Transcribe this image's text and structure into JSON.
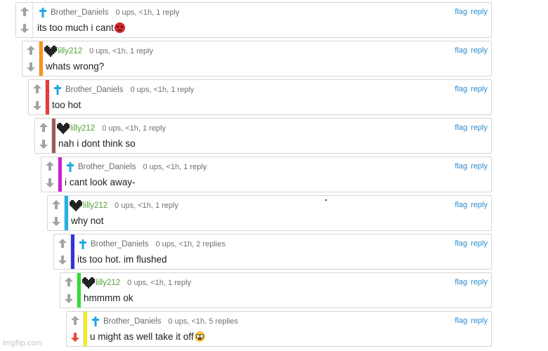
{
  "actions": {
    "flag": "flag",
    "reply": "reply"
  },
  "watermark": "imgflip.com",
  "colors": {
    "link": "#2a8bd0",
    "cross_icon": "#1ea8e0",
    "green_username": "#4fa33a",
    "vote_arrow": "#a3a3a3",
    "downvoted_arrow": "#e64a3b"
  },
  "comments": [
    {
      "role_icon": "cross-icon",
      "username": "Brother_Daniels",
      "meta": "0 ups, <1h, 1 reply",
      "text": "its too much i cant",
      "emoji": "angry-face-emoji",
      "bar_color": ""
    },
    {
      "role_icon": "heart-icon",
      "username": "lilly212",
      "meta": "0 ups, <1h, 1 reply",
      "text": "whats wrong?",
      "bar_color": "#f7941d"
    },
    {
      "role_icon": "cross-icon",
      "username": "Brother_Daniels",
      "meta": "0 ups, <1h, 1 reply",
      "text": "too hot",
      "bar_color": "#e63b3b"
    },
    {
      "role_icon": "heart-icon",
      "username": "lilly212",
      "meta": "0 ups, <1h, 1 reply",
      "text": "nah i dont think so",
      "bar_color": "#9c5a58"
    },
    {
      "role_icon": "cross-icon",
      "username": "Brother_Daniels",
      "meta": "0 ups, <1h, 1 reply",
      "text": "i cant look away-",
      "bar_color": "#cc22cc"
    },
    {
      "role_icon": "heart-icon",
      "username": "lilly212",
      "meta": "0 ups, <1h, 1 reply",
      "text": "why not",
      "bar_color": "#22b3e6"
    },
    {
      "role_icon": "cross-icon",
      "username": "Brother_Daniels",
      "meta": "0 ups, <1h, 2 replies",
      "text": "its too hot. im flushed",
      "bar_color": "#3333dd"
    },
    {
      "role_icon": "heart-icon",
      "username": "lilly212",
      "meta": "0 ups, <1h, 1 reply",
      "text": "hmmmm ok",
      "bar_color": "#33dd33"
    },
    {
      "role_icon": "cross-icon",
      "username": "Brother_Daniels",
      "meta": "0 ups, <1h, 5 replies",
      "text": "u might as well take it off",
      "emoji": "flushed-face-emoji",
      "bar_color": "#eeee22",
      "downvoted": true
    }
  ]
}
